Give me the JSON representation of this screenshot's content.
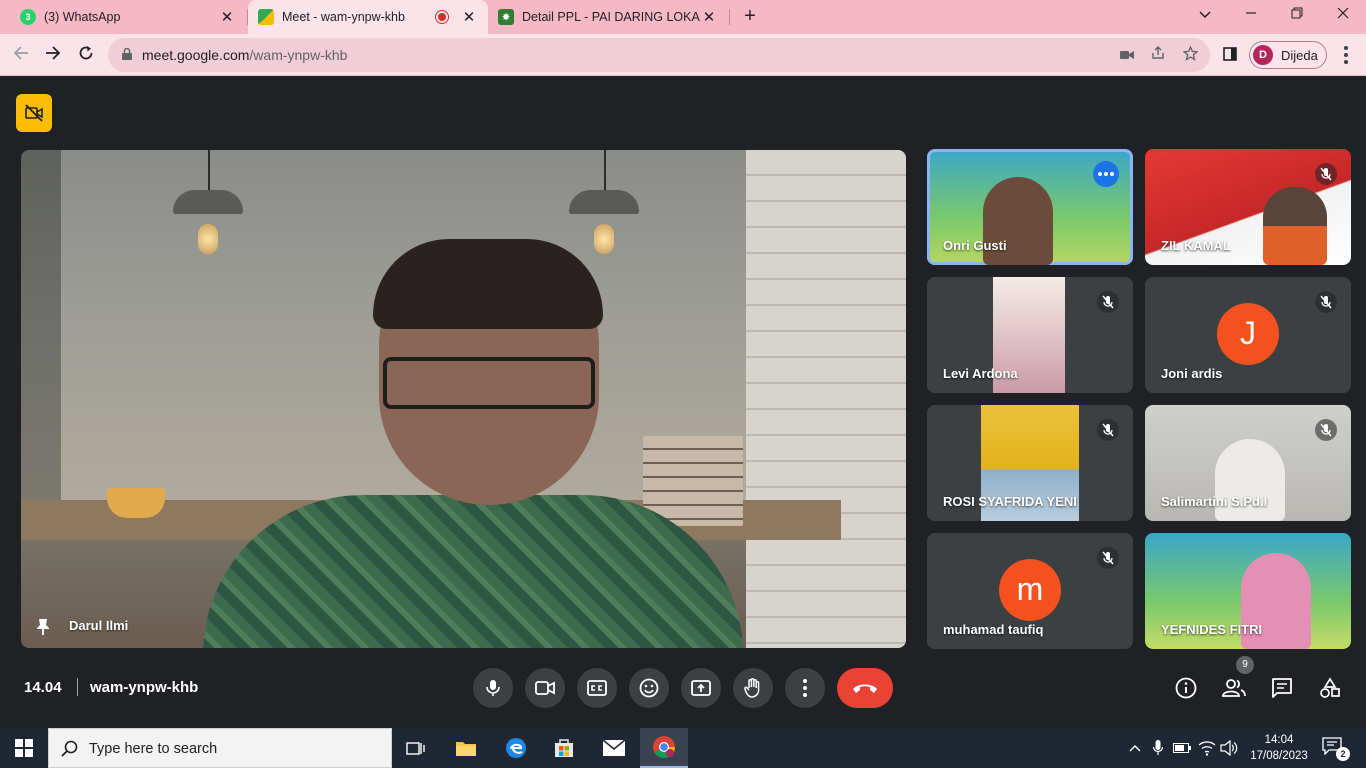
{
  "browser": {
    "tabs": [
      {
        "title": "(3) WhatsApp",
        "badge": "3",
        "favicon": "whatsapp-icon",
        "active": false
      },
      {
        "title": "Meet - wam-ynpw-khb",
        "favicon": "google-meet-icon",
        "active": true
      },
      {
        "title": "Detail PPL - PAI DARING LOKAKARYA",
        "favicon": "kemenag-icon",
        "active": false
      }
    ],
    "url_host": "meet.google.com",
    "url_path": "/wam-ynpw-khb",
    "profile_initial": "D",
    "profile_name": "Dijeda",
    "accent": "#f7b8c6"
  },
  "meet": {
    "main_speaker": "Darul Ilmi",
    "participants": [
      {
        "name": "Onri Gusti",
        "speaking": true
      },
      {
        "name": "ZIL KAMAL",
        "muted": true
      },
      {
        "name": "Levi Ardona",
        "muted": true
      },
      {
        "name": "Joni ardis",
        "muted": true,
        "initial": "J",
        "color": "#f4511e"
      },
      {
        "name": "ROSI SYAFRIDA YENI",
        "muted": true
      },
      {
        "name": "Salimartini S.Pd.I",
        "muted": true
      },
      {
        "name": "muhamad taufiq",
        "muted": true,
        "initial": "m",
        "color": "#f4511e"
      },
      {
        "name": "YEFNIDES FITRI",
        "muted": false
      }
    ],
    "time": "14.04",
    "meeting_code": "wam-ynpw-khb",
    "people_count": "9",
    "end_call_color": "#ea4335"
  },
  "taskbar": {
    "search_placeholder": "Type here to search",
    "time": "14:04",
    "date": "17/08/2023",
    "notification_count": "2"
  }
}
